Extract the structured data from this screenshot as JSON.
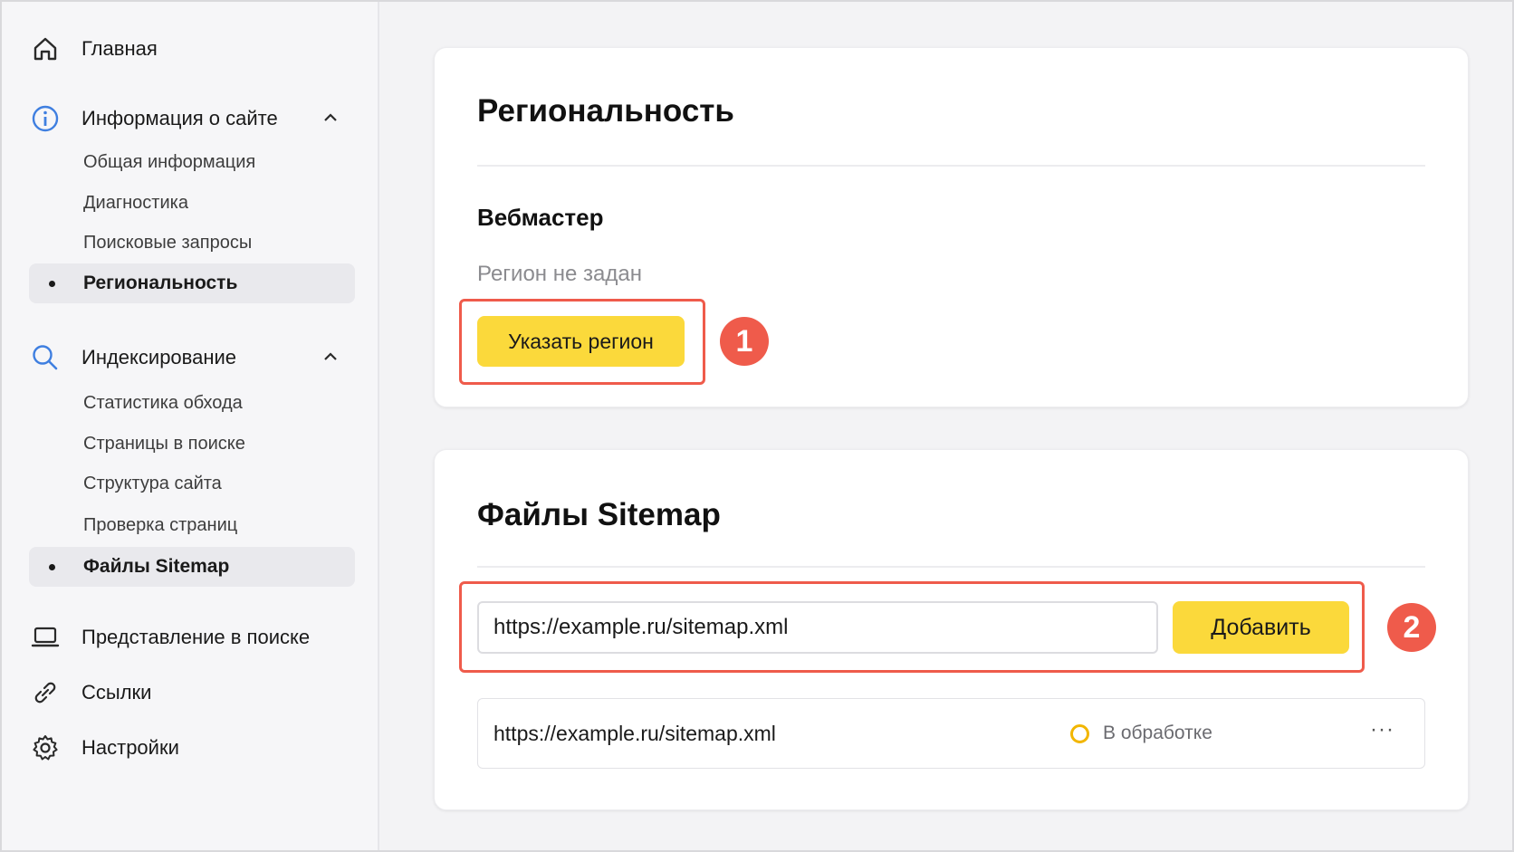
{
  "sidebar": {
    "home": "Главная",
    "site_info": {
      "label": "Информация о сайте",
      "items": [
        "Общая информация",
        "Диагностика",
        "Поисковые запросы",
        "Региональность"
      ]
    },
    "indexing": {
      "label": "Индексирование",
      "items": [
        "Статистика обхода",
        "Страницы в поиске",
        "Структура сайта",
        "Проверка страниц",
        "Файлы Sitemap"
      ]
    },
    "search_view": "Представление в поиске",
    "links": "Ссылки",
    "settings": "Настройки"
  },
  "regional_card": {
    "title": "Региональность",
    "section": "Вебмастер",
    "status": "Регион не задан",
    "button": "Указать регион",
    "badge": "1"
  },
  "sitemap_card": {
    "title": "Файлы Sitemap",
    "input_value": "https://example.ru/sitemap.xml",
    "button": "Добавить",
    "badge": "2",
    "rows": [
      {
        "url": "https://example.ru/sitemap.xml",
        "status": "В обработке",
        "menu": "···"
      }
    ]
  },
  "colors": {
    "accent_yellow": "#fbd93b",
    "highlight_red": "#ef5b4b",
    "status_pending": "#f2b600",
    "icon_blue": "#3f7fe0"
  }
}
